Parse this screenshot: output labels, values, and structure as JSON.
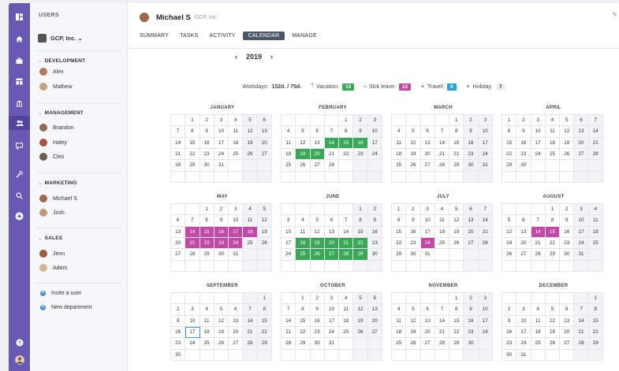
{
  "sidebar": {
    "header": "USERS",
    "company": "GCP, Inc. ⌄",
    "groups": [
      {
        "name": "DEVELOPMENT",
        "members": [
          {
            "name": "Alex"
          },
          {
            "name": "Mathew"
          }
        ]
      },
      {
        "name": "MANAGEMENT",
        "members": [
          {
            "name": "Brandon"
          },
          {
            "name": "Haley"
          },
          {
            "name": "Cleo"
          }
        ]
      },
      {
        "name": "MARKETING",
        "members": [
          {
            "name": "Michael S"
          },
          {
            "name": "Josh"
          }
        ]
      },
      {
        "name": "SALES",
        "members": [
          {
            "name": "Jenn"
          },
          {
            "name": "Adam"
          }
        ]
      }
    ],
    "actions": [
      "Invite a user",
      "New department"
    ]
  },
  "header": {
    "user_name": "Michael S",
    "company": "GCP, Inc.",
    "tabs": [
      "SUMMARY",
      "TASKS",
      "ACTIVITY",
      "CALENDAR",
      "MANAGE"
    ],
    "active_tab": "CALENDAR",
    "year": "2019"
  },
  "stats": {
    "workdays_label": "Workdays:",
    "workdays_value": "152d. / 75d.",
    "vacation_label": "Vacation:",
    "vacation_value": "15",
    "sick_label": "Sick leave:",
    "sick_value": "12",
    "travel_label": "Travel:",
    "travel_value": "0",
    "holiday_label": "Holiday:",
    "holiday_value": "7"
  },
  "colors": {
    "vacation": "#3aa957",
    "sick": "#c24aa6",
    "travel": "#2aa0d8",
    "accent": "#6a58b5"
  },
  "weekday_headers": [],
  "months": [
    {
      "name": "JANUARY",
      "offset": 1,
      "days": 31,
      "vacation": [],
      "sick": []
    },
    {
      "name": "FEBRUARY",
      "offset": 4,
      "days": 28,
      "vacation": [
        14,
        15,
        16,
        19,
        20
      ],
      "sick": []
    },
    {
      "name": "MARCH",
      "offset": 4,
      "days": 31,
      "vacation": [],
      "sick": []
    },
    {
      "name": "APRIL",
      "offset": 0,
      "days": 30,
      "vacation": [],
      "sick": []
    },
    {
      "name": "MAY",
      "offset": 2,
      "days": 31,
      "vacation": [],
      "sick": [
        14,
        15,
        16,
        17,
        18,
        21,
        22,
        23,
        24
      ]
    },
    {
      "name": "JUNE",
      "offset": 5,
      "days": 30,
      "vacation": [
        18,
        19,
        20,
        21,
        22,
        25,
        26,
        27,
        28,
        29
      ],
      "sick": []
    },
    {
      "name": "JULY",
      "offset": 0,
      "days": 31,
      "vacation": [],
      "sick": [
        24
      ]
    },
    {
      "name": "AUGUST",
      "offset": 3,
      "days": 31,
      "vacation": [],
      "sick": [
        14,
        15
      ]
    },
    {
      "name": "SEPTEMBER",
      "offset": 6,
      "days": 30,
      "vacation": [],
      "sick": []
    },
    {
      "name": "OCTOBER",
      "offset": 1,
      "days": 31,
      "vacation": [],
      "sick": []
    },
    {
      "name": "NOVEMBER",
      "offset": 4,
      "days": 30,
      "vacation": [],
      "sick": []
    },
    {
      "name": "DECEMBER",
      "offset": 6,
      "days": 31,
      "vacation": [],
      "sick": []
    }
  ],
  "today": {
    "month": 8,
    "day": 17
  },
  "icons": [
    "logo-icon",
    "home-icon",
    "briefcase-icon",
    "dashboard-icon",
    "bank-icon",
    "users-icon",
    "chat-icon",
    "tools-icon",
    "search-icon",
    "add-icon",
    "help-icon",
    "profile-avatar"
  ]
}
